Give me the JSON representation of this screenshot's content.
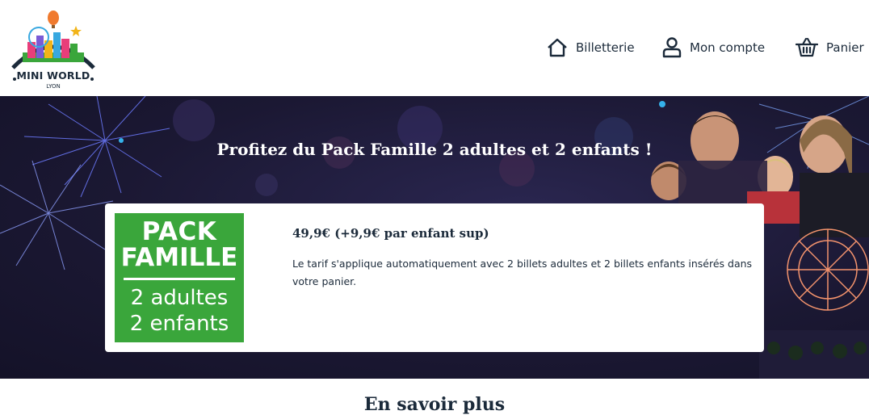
{
  "logo": {
    "name": "MINI WORLD",
    "city": "LYON"
  },
  "nav": [
    {
      "label": "Billetterie",
      "icon": "home-icon"
    },
    {
      "label": "Mon compte",
      "icon": "user-icon"
    },
    {
      "label": "Panier",
      "icon": "basket-icon"
    }
  ],
  "banner": {
    "title": "Profitez du Pack Famille 2 adultes et 2 enfants !"
  },
  "offer": {
    "badge": {
      "line1": "PACK",
      "line2": "FAMILLE",
      "line3": "2 adultes",
      "line4": "2 enfants"
    },
    "price": "49,9€ (+9,9€ par enfant sup)",
    "description": "Le tarif s'applique automatiquement avec 2 billets adultes et 2 billets enfants insérés dans votre panier."
  },
  "section": {
    "title": "En savoir plus"
  },
  "colors": {
    "text": "#1b2a3a",
    "banner_bg": "#1b1833",
    "badge_green": "#3aa63b",
    "card_bg": "#ffffff"
  }
}
